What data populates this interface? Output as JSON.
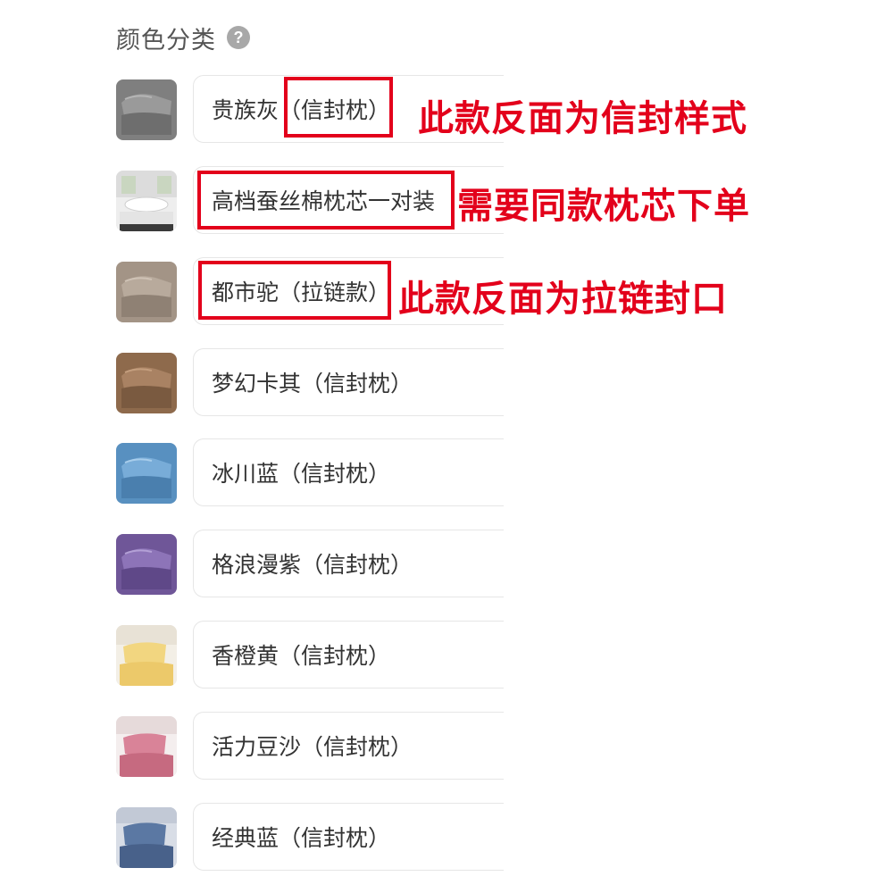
{
  "header": {
    "title": "颜色分类",
    "help_icon": "question-circle-icon",
    "help_glyph": "?"
  },
  "options": [
    {
      "label": "贵族灰（信封枕）",
      "swatch": "#8a8a8a",
      "icon": "gray-pillow-thumbnail"
    },
    {
      "label": "高档蚕丝棉枕芯一对装",
      "swatch": "#f2f2f2",
      "icon": "white-pillow-core-thumbnail"
    },
    {
      "label": "都市驼（拉链款）",
      "swatch": "#a89a8e",
      "icon": "camel-pillow-thumbnail"
    },
    {
      "label": "梦幻卡其（信封枕）",
      "swatch": "#9c7656",
      "icon": "khaki-pillow-thumbnail"
    },
    {
      "label": "冰川蓝（信封枕）",
      "swatch": "#5f9ccc",
      "icon": "blue-pillow-thumbnail"
    },
    {
      "label": "格浪漫紫（信封枕）",
      "swatch": "#7d62a8",
      "icon": "purple-pillow-thumbnail"
    },
    {
      "label": "香橙黄（信封枕）",
      "swatch": "#f0d88a",
      "icon": "yellow-pillow-thumbnail"
    },
    {
      "label": "活力豆沙（信封枕）",
      "swatch": "#d07a8e",
      "icon": "pink-pillow-thumbnail"
    },
    {
      "label": "经典蓝（信封枕）",
      "swatch": "#4f6a94",
      "icon": "navy-pillow-thumbnail"
    }
  ],
  "annotations": [
    {
      "text": "此款反面为信封样式"
    },
    {
      "text": "需要同款枕芯下单"
    },
    {
      "text": "此款反面为拉链封口"
    }
  ],
  "colors": {
    "annotation_red": "#e3001b",
    "border": "#e6e6e6",
    "text": "#333333"
  }
}
